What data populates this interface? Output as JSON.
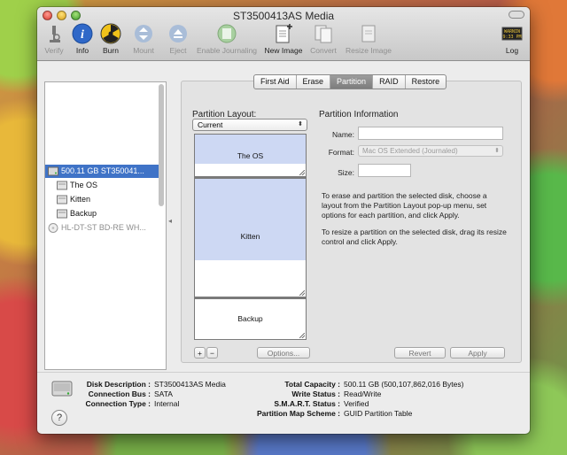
{
  "window": {
    "title": "ST3500413AS Media"
  },
  "toolbar": {
    "items": [
      {
        "label": "Verify",
        "icon": "microscope-icon",
        "enabled": false
      },
      {
        "label": "Info",
        "icon": "info-icon",
        "enabled": true
      },
      {
        "label": "Burn",
        "icon": "burn-icon",
        "enabled": true
      },
      {
        "label": "Mount",
        "icon": "mount-icon",
        "enabled": false
      },
      {
        "label": "Eject",
        "icon": "eject-icon",
        "enabled": false
      },
      {
        "label": "Enable Journaling",
        "icon": "journaling-icon",
        "enabled": false
      },
      {
        "label": "New Image",
        "icon": "new-image-icon",
        "enabled": true
      },
      {
        "label": "Convert",
        "icon": "convert-icon",
        "enabled": false
      },
      {
        "label": "Resize Image",
        "icon": "resize-image-icon",
        "enabled": false
      },
      {
        "label": "Log",
        "icon": "log-icon",
        "enabled": true
      }
    ],
    "log_icon_text": "WARNIN\n9:33 PM"
  },
  "sidebar": {
    "items": [
      {
        "label": "500.11 GB ST350041...",
        "kind": "disk",
        "selected": true
      },
      {
        "label": "The OS",
        "kind": "volume",
        "selected": false
      },
      {
        "label": "Kitten",
        "kind": "volume",
        "selected": false
      },
      {
        "label": "Backup",
        "kind": "volume",
        "selected": false
      },
      {
        "label": "HL-DT-ST BD-RE WH...",
        "kind": "optical",
        "selected": false
      }
    ]
  },
  "tabs": [
    {
      "label": "First Aid",
      "active": false
    },
    {
      "label": "Erase",
      "active": false
    },
    {
      "label": "Partition",
      "active": true
    },
    {
      "label": "RAID",
      "active": false
    },
    {
      "label": "Restore",
      "active": false
    }
  ],
  "partition": {
    "layout_heading": "Partition Layout:",
    "layout_value": "Current",
    "partitions": [
      {
        "name": "The OS",
        "used_fraction": 0.7
      },
      {
        "name": "Kitten",
        "used_fraction": 0.69
      },
      {
        "name": "Backup",
        "used_fraction": 0.0
      }
    ],
    "add_label": "+",
    "remove_label": "−",
    "options_label": "Options...",
    "revert_label": "Revert",
    "apply_label": "Apply"
  },
  "info": {
    "heading": "Partition Information",
    "name_label": "Name:",
    "name_value": "",
    "format_label": "Format:",
    "format_value": "Mac OS Extended (Journaled)",
    "size_label": "Size:",
    "size_value": "",
    "desc1": "To erase and partition the selected disk, choose a layout from the Partition Layout pop-up menu, set options for each partition, and click Apply.",
    "desc2": "To resize a partition on the selected disk, drag its resize control and click Apply."
  },
  "disk_info": {
    "left": [
      {
        "key": "Disk Description :",
        "value": "ST3500413AS Media"
      },
      {
        "key": "Connection Bus :",
        "value": "SATA"
      },
      {
        "key": "Connection Type :",
        "value": "Internal"
      }
    ],
    "right": [
      {
        "key": "Total Capacity :",
        "value": "500.11 GB (500,107,862,016 Bytes)"
      },
      {
        "key": "Write Status :",
        "value": "Read/Write"
      },
      {
        "key": "S.M.A.R.T. Status :",
        "value": "Verified"
      },
      {
        "key": "Partition Map Scheme :",
        "value": "GUID Partition Table"
      }
    ]
  },
  "help_label": "?"
}
